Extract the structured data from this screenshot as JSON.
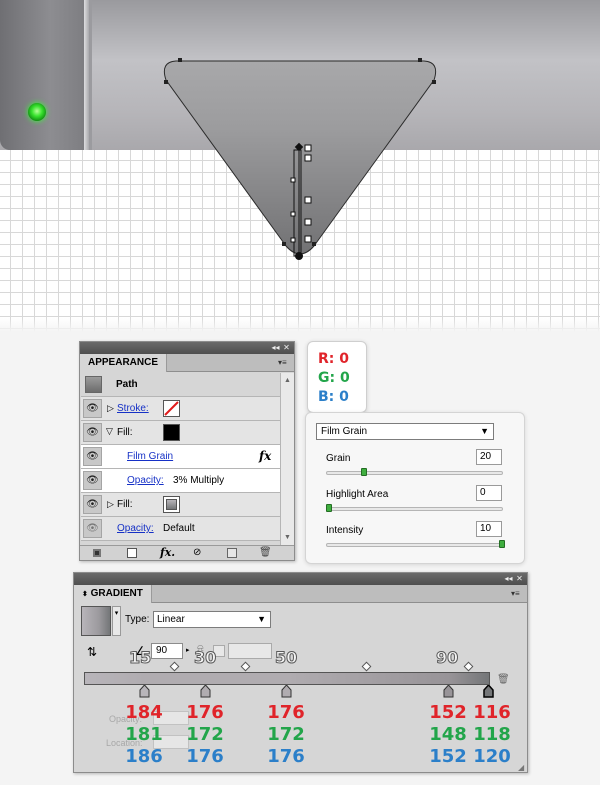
{
  "appearance": {
    "tab": "APPEARANCE",
    "object": "Path",
    "rows": {
      "stroke": "Stroke:",
      "fill1": "Fill:",
      "effect": "Film Grain",
      "fx": "fx",
      "opacity1_label": "Opacity:",
      "opacity1_value": "3% Multiply",
      "fill2": "Fill:",
      "opacity2_label": "Opacity:",
      "opacity2_value": "Default"
    },
    "footer_fx": "fx."
  },
  "rgb_chip": {
    "r": "R: 0",
    "g": "G: 0",
    "b": "B: 0"
  },
  "film_grain": {
    "filter": "Film Grain",
    "grain_label": "Grain",
    "grain_value": "20",
    "highlight_label": "Highlight Area",
    "highlight_value": "0",
    "intensity_label": "Intensity",
    "intensity_value": "10",
    "grain_level": 0.2,
    "highlight_level": 0.0,
    "intensity_level": 1.0
  },
  "gradient": {
    "tab": "GRADIENT",
    "type_label": "Type:",
    "type_value": "Linear",
    "angle_value": "90",
    "opacity_label": "Opacity:",
    "location_label": "Location:",
    "markers": [
      "15",
      "30",
      "50",
      "90"
    ],
    "stops": [
      {
        "r": "184",
        "g": "181",
        "b": "186"
      },
      {
        "r": "176",
        "g": "172",
        "b": "176"
      },
      {
        "r": "176",
        "g": "172",
        "b": "176"
      },
      {
        "r": "152",
        "g": "148",
        "b": "152"
      },
      {
        "r": "116",
        "g": "118",
        "b": "120"
      }
    ]
  },
  "colors": {
    "red": "#e0242a",
    "green": "#22a54a",
    "blue": "#2b7fc9",
    "led": "#35e02b"
  }
}
